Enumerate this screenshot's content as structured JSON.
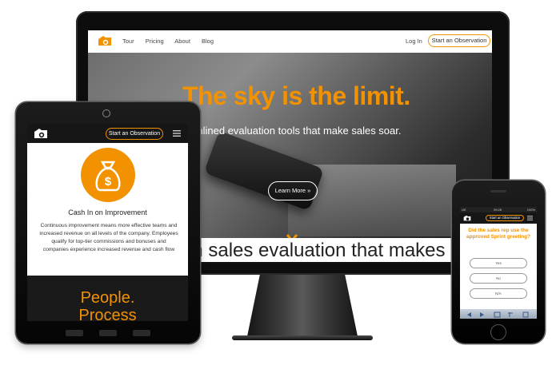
{
  "desktop": {
    "nav_links": [
      "Tour",
      "Pricing",
      "About",
      "Blog"
    ],
    "login_label": "Log In",
    "cta_label": "Start an Observation",
    "hero_title": "The sky is the limit.",
    "hero_subtitle": "reamlined evaluation tools that make sales soar.",
    "learn_more_label": "Learn More »",
    "strip_text": "en sales evaluation that makes"
  },
  "tablet": {
    "cta_label": "Start an Observation",
    "section_heading": "Cash In on Improvement",
    "section_body": "Continuous improvement means more effective teams and increased revenue on all levels of the company. Employees qualify for top-tier commissions and bonuses and companies experience increased revenue and cash flow",
    "big_text_1": "People.",
    "big_text_2": "Process"
  },
  "phone": {
    "status_left": "UK",
    "status_center": "09:28",
    "status_right": "100%",
    "cta_label": "Start an Observation",
    "question": "Did the sales rep use the approved Sprint greeting?",
    "options": [
      "Yes",
      "No",
      "N/A"
    ]
  },
  "colors": {
    "accent": "#f39200",
    "dark": "#161616"
  }
}
